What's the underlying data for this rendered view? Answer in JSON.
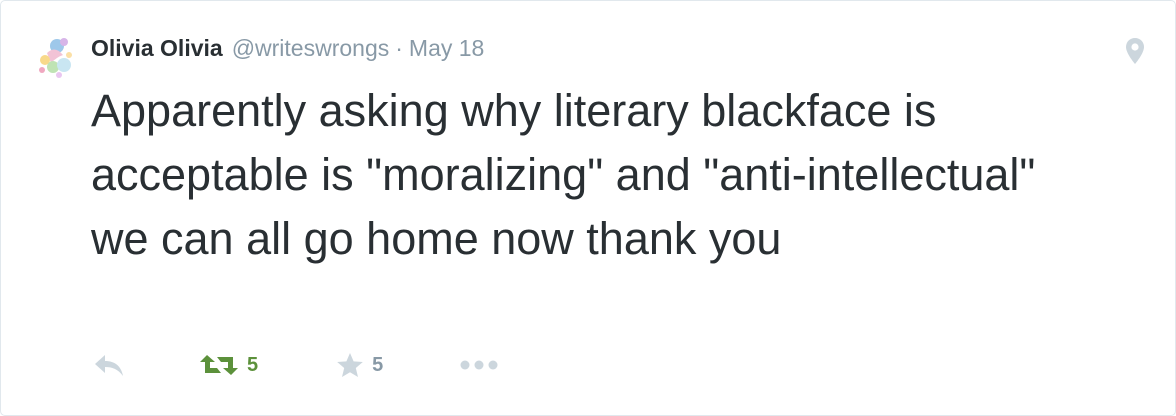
{
  "tweet": {
    "fullname": "Olivia Olivia",
    "username": "@writeswrongs",
    "separator": "·",
    "timestamp": "May 18",
    "text": "Apparently asking why literary blackface is acceptable is \"moralizing\" and \"anti-intellectual\" we can all go home now thank you"
  },
  "actions": {
    "reply_icon": "reply-icon",
    "retweet_icon": "retweet-icon",
    "retweet_count": "5",
    "favorite_icon": "star-icon",
    "favorite_count": "5",
    "more_icon": "more-dots-icon"
  },
  "icons": {
    "geo": "location-pin-icon",
    "avatar": "avatar-image"
  },
  "colors": {
    "text": "#292f33",
    "secondary": "#8899a6",
    "icon_gray": "#ccd6dd",
    "retweet_green": "#5c913b",
    "border": "#e1e8ed"
  }
}
